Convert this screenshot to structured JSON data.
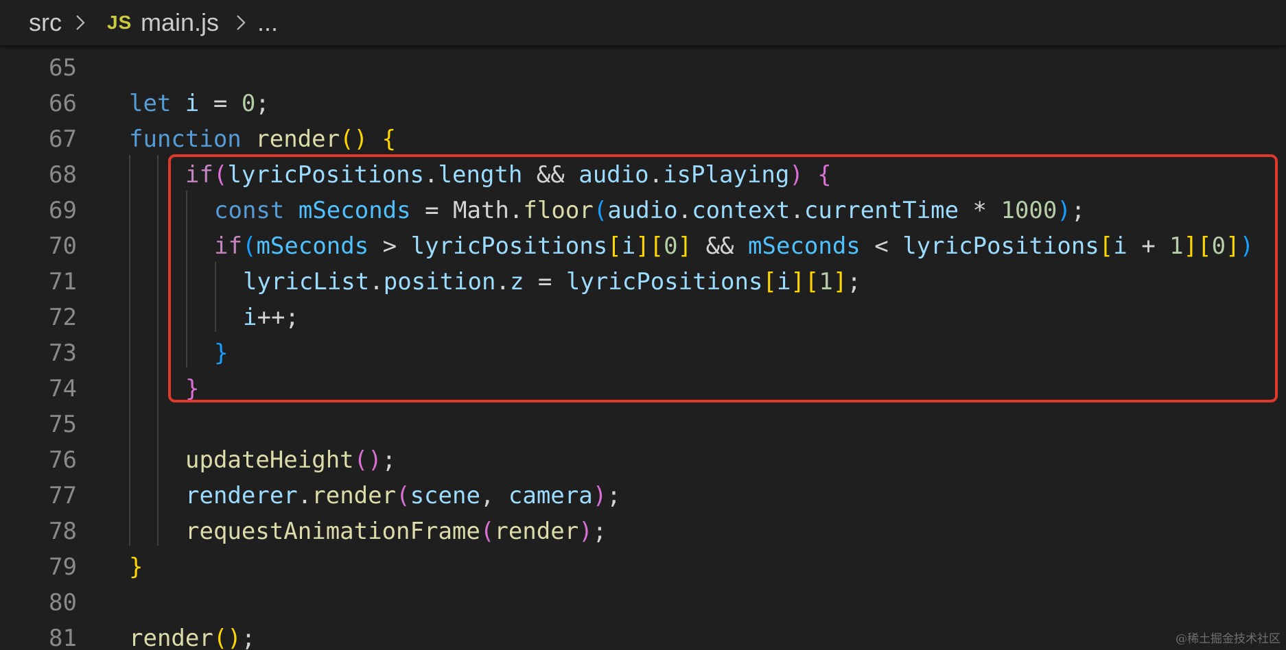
{
  "colors": {
    "background": "#1f1f1f",
    "keyword": "#569cd6",
    "control": "#c586c0",
    "variable": "#9cdcfe",
    "constant": "#4fc1ff",
    "function": "#dcdcaa",
    "number": "#b5cea8",
    "plain": "#d4d4d4",
    "bracket1": "#ffd700",
    "bracket2": "#da70d6",
    "bracket3": "#179fff",
    "line_number": "#8a8a8a",
    "highlight_border": "#e0392b"
  },
  "breadcrumb": {
    "folder": "src",
    "file_icon": "JS",
    "file": "main.js",
    "ellipsis": "...",
    "icons": [
      "chevron-right-icon",
      "js-file-icon"
    ]
  },
  "lines": [
    {
      "num": "65",
      "tokens": []
    },
    {
      "num": "66",
      "tokens": [
        [
          "let",
          "keyword"
        ],
        [
          " ",
          "plain"
        ],
        [
          "i",
          "variable"
        ],
        [
          " = ",
          "plain"
        ],
        [
          "0",
          "number"
        ],
        [
          ";",
          "plain"
        ]
      ]
    },
    {
      "num": "67",
      "tokens": [
        [
          "function",
          "keyword"
        ],
        [
          " ",
          "plain"
        ],
        [
          "render",
          "function"
        ],
        [
          "()",
          "bracket1"
        ],
        [
          " ",
          "plain"
        ],
        [
          "{",
          "bracket1"
        ]
      ]
    },
    {
      "num": "68",
      "tokens": [
        [
          "if",
          "control"
        ],
        [
          "(",
          "bracket2"
        ],
        [
          "lyricPositions",
          "variable"
        ],
        [
          ".",
          "plain"
        ],
        [
          "length",
          "variable"
        ],
        [
          " && ",
          "plain"
        ],
        [
          "audio",
          "variable"
        ],
        [
          ".",
          "plain"
        ],
        [
          "isPlaying",
          "variable"
        ],
        [
          ")",
          "bracket2"
        ],
        [
          " ",
          "plain"
        ],
        [
          "{",
          "bracket2"
        ]
      ]
    },
    {
      "num": "69",
      "tokens": [
        [
          "const",
          "keyword"
        ],
        [
          " ",
          "plain"
        ],
        [
          "mSeconds",
          "constant"
        ],
        [
          " = ",
          "plain"
        ],
        [
          "Math",
          "plain"
        ],
        [
          ".",
          "plain"
        ],
        [
          "floor",
          "function"
        ],
        [
          "(",
          "bracket3"
        ],
        [
          "audio",
          "variable"
        ],
        [
          ".",
          "plain"
        ],
        [
          "context",
          "variable"
        ],
        [
          ".",
          "plain"
        ],
        [
          "currentTime",
          "variable"
        ],
        [
          " * ",
          "plain"
        ],
        [
          "1000",
          "number"
        ],
        [
          ")",
          "bracket3"
        ],
        [
          ";",
          "plain"
        ]
      ]
    },
    {
      "num": "70",
      "tokens": [
        [
          "if",
          "control"
        ],
        [
          "(",
          "bracket3"
        ],
        [
          "mSeconds",
          "constant"
        ],
        [
          " > ",
          "plain"
        ],
        [
          "lyricPositions",
          "variable"
        ],
        [
          "[",
          "bracket1"
        ],
        [
          "i",
          "variable"
        ],
        [
          "]",
          "bracket1"
        ],
        [
          "[",
          "bracket1"
        ],
        [
          "0",
          "number"
        ],
        [
          "]",
          "bracket1"
        ],
        [
          " && ",
          "plain"
        ],
        [
          "mSeconds",
          "constant"
        ],
        [
          " < ",
          "plain"
        ],
        [
          "lyricPositions",
          "variable"
        ],
        [
          "[",
          "bracket1"
        ],
        [
          "i",
          "variable"
        ],
        [
          " + ",
          "plain"
        ],
        [
          "1",
          "number"
        ],
        [
          "]",
          "bracket1"
        ],
        [
          "[",
          "bracket1"
        ],
        [
          "0",
          "number"
        ],
        [
          "]",
          "bracket1"
        ],
        [
          ")",
          "bracket3"
        ]
      ]
    },
    {
      "num": "71",
      "tokens": [
        [
          "lyricList",
          "variable"
        ],
        [
          ".",
          "plain"
        ],
        [
          "position",
          "variable"
        ],
        [
          ".",
          "plain"
        ],
        [
          "z",
          "variable"
        ],
        [
          " = ",
          "plain"
        ],
        [
          "lyricPositions",
          "variable"
        ],
        [
          "[",
          "bracket1"
        ],
        [
          "i",
          "variable"
        ],
        [
          "]",
          "bracket1"
        ],
        [
          "[",
          "bracket1"
        ],
        [
          "1",
          "number"
        ],
        [
          "]",
          "bracket1"
        ],
        [
          ";",
          "plain"
        ]
      ]
    },
    {
      "num": "72",
      "tokens": [
        [
          "i",
          "variable"
        ],
        [
          "++;",
          "plain"
        ]
      ]
    },
    {
      "num": "73",
      "tokens": [
        [
          "}",
          "bracket3"
        ]
      ]
    },
    {
      "num": "74",
      "tokens": [
        [
          "}",
          "bracket2"
        ]
      ]
    },
    {
      "num": "75",
      "tokens": []
    },
    {
      "num": "76",
      "tokens": [
        [
          "updateHeight",
          "function"
        ],
        [
          "()",
          "bracket2"
        ],
        [
          ";",
          "plain"
        ]
      ]
    },
    {
      "num": "77",
      "tokens": [
        [
          "renderer",
          "variable"
        ],
        [
          ".",
          "plain"
        ],
        [
          "render",
          "function"
        ],
        [
          "(",
          "bracket2"
        ],
        [
          "scene",
          "variable"
        ],
        [
          ", ",
          "plain"
        ],
        [
          "camera",
          "variable"
        ],
        [
          ")",
          "bracket2"
        ],
        [
          ";",
          "plain"
        ]
      ]
    },
    {
      "num": "78",
      "tokens": [
        [
          "requestAnimationFrame",
          "function"
        ],
        [
          "(",
          "bracket2"
        ],
        [
          "render",
          "function"
        ],
        [
          ")",
          "bracket2"
        ],
        [
          ";",
          "plain"
        ]
      ]
    },
    {
      "num": "79",
      "tokens": [
        [
          "}",
          "bracket1"
        ]
      ]
    },
    {
      "num": "80",
      "tokens": []
    },
    {
      "num": "81",
      "tokens": [
        [
          "render",
          "function"
        ],
        [
          "()",
          "bracket1"
        ],
        [
          ";",
          "plain"
        ]
      ]
    }
  ],
  "watermark": "@稀土掘金技术社区"
}
